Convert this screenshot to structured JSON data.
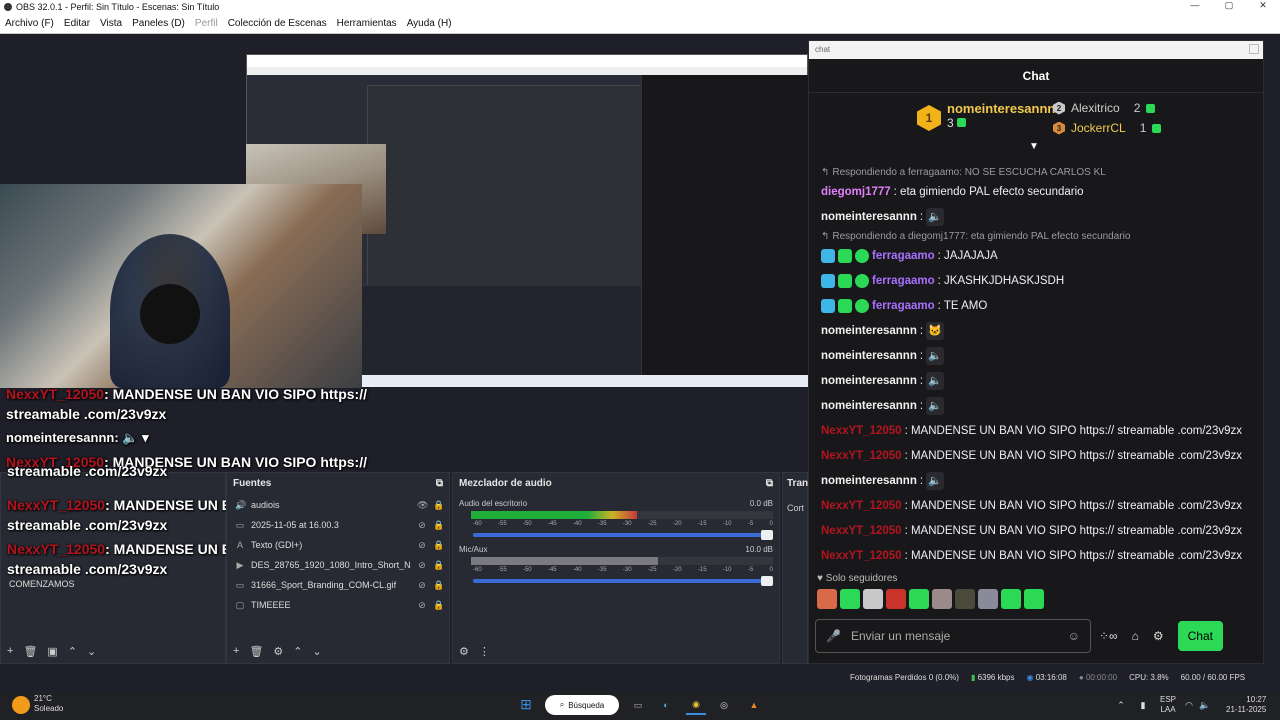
{
  "window": {
    "title": "OBS 32.0.1 - Perfil: Sin Título - Escenas: Sin Título",
    "controls": [
      "—",
      "▢",
      "✕"
    ]
  },
  "menu": {
    "items": [
      "Archivo (F)",
      "Editar",
      "Vista",
      "Paneles (D)",
      "Perfil",
      "Colección de Escenas",
      "Herramientas",
      "Ayuda (H)"
    ]
  },
  "overlay": {
    "lines": [
      {
        "user": "NexxYT_12050",
        "text": ": MANDENSE UN BAN VIO SIPO https://",
        "cont": "streamable .com/23v9zx"
      },
      {
        "user": "nomeinteresannn",
        "text": ":",
        "icon": "speaker-icon"
      },
      {
        "user": "NexxYT_12050",
        "text": ": MANDENSE UN BAN VIO SIPO https://",
        "cont": "streamable .com/23v9zx"
      },
      {
        "user": "NexxYT_12050",
        "text": ": MANDENSE UN BAN VIO SIPO https://",
        "cont": "streamable .com/23v9zx"
      },
      {
        "user": "NexxYT_12050",
        "text": ": MANDENSE UN BAN VIO SIPO https://",
        "cont": "streamable .com/23v9zx"
      }
    ],
    "scene_label": "COMENZAMOS"
  },
  "docks": {
    "sources": {
      "title": "Fuentes",
      "items": [
        "audiois",
        "2025-11-05 at 16.00.3",
        "Texto (GDI+)",
        "DES_28765_1920_1080_Intro_Short_Nc",
        "31666_Sport_Branding_COM-CL.gif",
        "TIMEEEE"
      ]
    },
    "mixer": {
      "title": "Mezclador de audio",
      "channels": [
        {
          "name": "Audio del escritorio",
          "db": "0.0 dB",
          "level": 0.55
        },
        {
          "name": "Mic/Aux",
          "db": "10.0 dB",
          "level": 0.62
        }
      ],
      "ticks": [
        "-60",
        "-55",
        "-50",
        "-45",
        "-40",
        "-35",
        "-30",
        "-25",
        "-20",
        "-15",
        "-10",
        "-5",
        "0"
      ]
    },
    "transitions": {
      "title": "Tran",
      "value": "Cort"
    }
  },
  "chat": {
    "window_label": "chat",
    "title": "Chat",
    "leaderboard": {
      "first": {
        "rank": "1",
        "name": "nomeinteresannn",
        "bits": "3"
      },
      "second": {
        "rank": "2",
        "name": "Alexitrico",
        "bits": "2"
      },
      "third": {
        "rank": "3",
        "name": "JockerrCL",
        "bits": "1"
      }
    },
    "messages": [
      {
        "reply": "Respondiendo a ferragaamo: NO SE ESCUCHA CARLOS KL"
      },
      {
        "user": "diegomj1777",
        "color": "#e17ffa",
        "text": ": eta gimiendo PAL efecto secundario"
      },
      {
        "user": "nomeinteresannn",
        "color": "#f0f0f0",
        "text": ":",
        "emote": "🔈"
      },
      {
        "reply": "Respondiendo a diegomj1777: eta gimiendo PAL efecto secundario"
      },
      {
        "user": "ferragaamo",
        "color": "#a970ff",
        "badges": true,
        "text": ": JAJAJAJA"
      },
      {
        "user": "ferragaamo",
        "color": "#a970ff",
        "badges": true,
        "text": ": JKASHKJDHASKJSDH"
      },
      {
        "user": "ferragaamo",
        "color": "#a970ff",
        "badges": true,
        "text": ": TE AMO"
      },
      {
        "user": "nomeinteresannn",
        "color": "#f0f0f0",
        "text": ":",
        "emote": "🐱"
      },
      {
        "user": "nomeinteresannn",
        "color": "#f0f0f0",
        "text": ":",
        "emote": "🔈"
      },
      {
        "user": "nomeinteresannn",
        "color": "#f0f0f0",
        "text": ":",
        "emote": "🔈"
      },
      {
        "user": "nomeinteresannn",
        "color": "#f0f0f0",
        "text": ":",
        "emote": "🔈"
      },
      {
        "user": "NexxYT_12050",
        "color": "#b3151f",
        "text": ": MANDENSE UN BAN VIO SIPO https:// streamable .com/23v9zx"
      },
      {
        "user": "NexxYT_12050",
        "color": "#b3151f",
        "text": ": MANDENSE UN BAN VIO SIPO https:// streamable .com/23v9zx"
      },
      {
        "user": "nomeinteresannn",
        "color": "#f0f0f0",
        "text": ":",
        "emote": "🔈"
      },
      {
        "user": "NexxYT_12050",
        "color": "#b3151f",
        "text": ": MANDENSE UN BAN VIO SIPO https:// streamable .com/23v9zx"
      },
      {
        "user": "NexxYT_12050",
        "color": "#b3151f",
        "text": ": MANDENSE UN BAN VIO SIPO https:// streamable .com/23v9zx"
      },
      {
        "user": "NexxYT_12050",
        "color": "#b3151f",
        "text": ": MANDENSE UN BAN VIO SIPO https:// streamable .com/23v9zx"
      }
    ],
    "followers_only": "Solo seguidores",
    "input_placeholder": "Enviar un mensaje",
    "send_label": "Chat"
  },
  "status": {
    "dropped": "Fotogramas Perdidos 0 (0.0%)",
    "bitrate": "6396 kbps",
    "stream_time": "03:16:08",
    "rec_time": "00:00:00",
    "cpu": "CPU: 3.8%",
    "fps": "60.00 / 60.00 FPS"
  },
  "taskbar": {
    "weather_temp": "21°C",
    "weather_desc": "Soleado",
    "search": "Búsqueda",
    "lang_top": "ESP",
    "lang_bottom": "LAA",
    "time": "10:27",
    "date": "21-11-2025"
  },
  "colors": {
    "accent_green": "#2bd957",
    "name_red": "#b3151f",
    "name_purple": "#a970ff",
    "name_pink": "#e17ffa",
    "gold": "#f2c94c"
  }
}
